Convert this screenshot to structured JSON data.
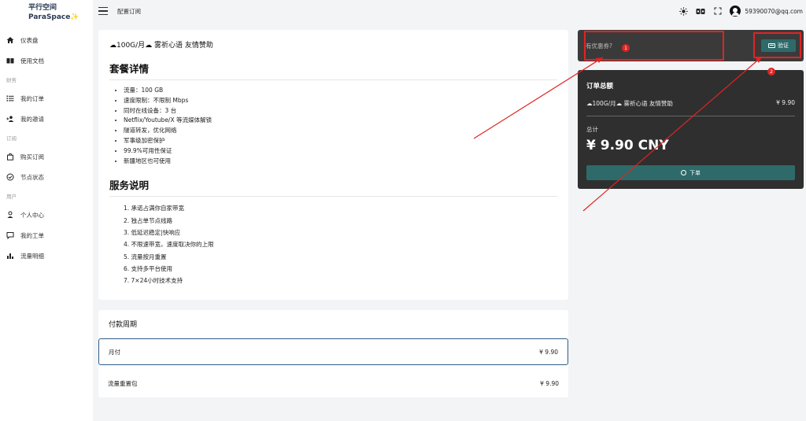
{
  "brand": {
    "name_line1": "平行空间",
    "name_line2": "ParaSpace",
    "sparkle": "✨"
  },
  "nav": {
    "dashboard": "仪表盘",
    "docs": "使用文档",
    "section_finance": "财务",
    "orders": "我的订单",
    "invites": "我的邀请",
    "section_subscribe": "订阅",
    "buy": "购买订阅",
    "node_status": "节点状态",
    "section_user": "用户",
    "profile": "个人中心",
    "tickets": "我的工单",
    "traffic": "流量明细"
  },
  "topbar": {
    "breadcrumb": "配置订阅",
    "user_email": "59390070@qq.com"
  },
  "plan": {
    "name": "☁100G/月☁ 雾祈心语 友情赞助",
    "details_title": "套餐详情",
    "details": [
      "流量：100 GB",
      "速度限制：不限制 Mbps",
      "同时在线设备：3 台",
      "Netflix/Youtube/X 等流媒体解锁",
      "隧道转发，优化网络",
      "军事级加密保护",
      "99.9%可用性保证",
      "新疆地区也可使用"
    ],
    "service_title": "服务说明",
    "service": [
      "1. 承诺占满你自家带宽",
      "2. 独占单节点线路",
      "3. 低延迟稳定|快响应",
      "4. 不限速带宽，速度取决你的上限",
      "5. 流量按月重置",
      "6. 支持多平台使用",
      "7. 7×24小时技术支持"
    ]
  },
  "period": {
    "title": "付款周期",
    "options": [
      {
        "label": "月付",
        "price": "¥ 9.90",
        "selected": true
      },
      {
        "label": "流量重置包",
        "price": "¥ 9.90",
        "selected": false
      }
    ]
  },
  "coupon": {
    "placeholder": "有优惠券?",
    "verify_label": "验证"
  },
  "order": {
    "title": "订单总额",
    "item_name": "☁100G/月☁ 雾祈心语 友情赞助",
    "item_price": "¥ 9.90",
    "total_label": "总计",
    "total_amount": "¥ 9.90 CNY",
    "submit_label": "下单"
  },
  "annotations": {
    "badge1": "1",
    "badge2": "2",
    "color": "#e02424"
  },
  "colors": {
    "accent": "#2e6a6a",
    "dark_card": "#2f2f2f",
    "coupon_card": "#3a3a3a",
    "selected_border": "#2f5d8a"
  }
}
